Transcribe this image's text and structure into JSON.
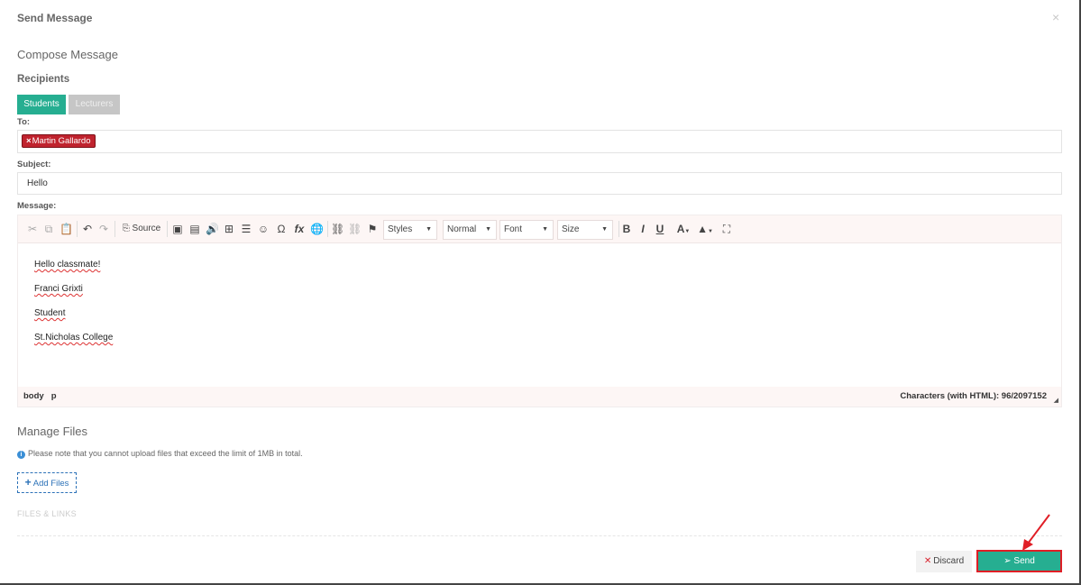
{
  "modal": {
    "title": "Send Message",
    "close": "×"
  },
  "compose": {
    "heading": "Compose Message",
    "recipients_label": "Recipients",
    "tabs": [
      {
        "label": "Students",
        "active": true
      },
      {
        "label": "Lecturers",
        "active": false
      }
    ],
    "to_label": "To:",
    "recipient_chip": "Martin Gallardo",
    "subject_label": "Subject:",
    "subject_value": "Hello",
    "message_label": "Message:"
  },
  "editor": {
    "source_label": "Source",
    "selects": {
      "styles": "Styles",
      "format": "Normal",
      "font": "Font",
      "size": "Size"
    },
    "content": [
      "Hello classmate!",
      "Franci Grixti",
      "Student",
      "St.Nicholas College"
    ],
    "path": [
      "body",
      "p"
    ],
    "char_count": "Characters (with HTML): 96/2097152"
  },
  "files": {
    "heading": "Manage Files",
    "note": "Please note that you cannot upload files that exceed the limit of 1MB in total.",
    "add_button": "Add Files",
    "section_label": "FILES & LINKS"
  },
  "actions": {
    "discard": "Discard",
    "send": "Send"
  },
  "colors": {
    "accent": "#26ae91",
    "danger": "#c0232e",
    "highlight": "#e01e26",
    "link": "#2c72b8"
  }
}
